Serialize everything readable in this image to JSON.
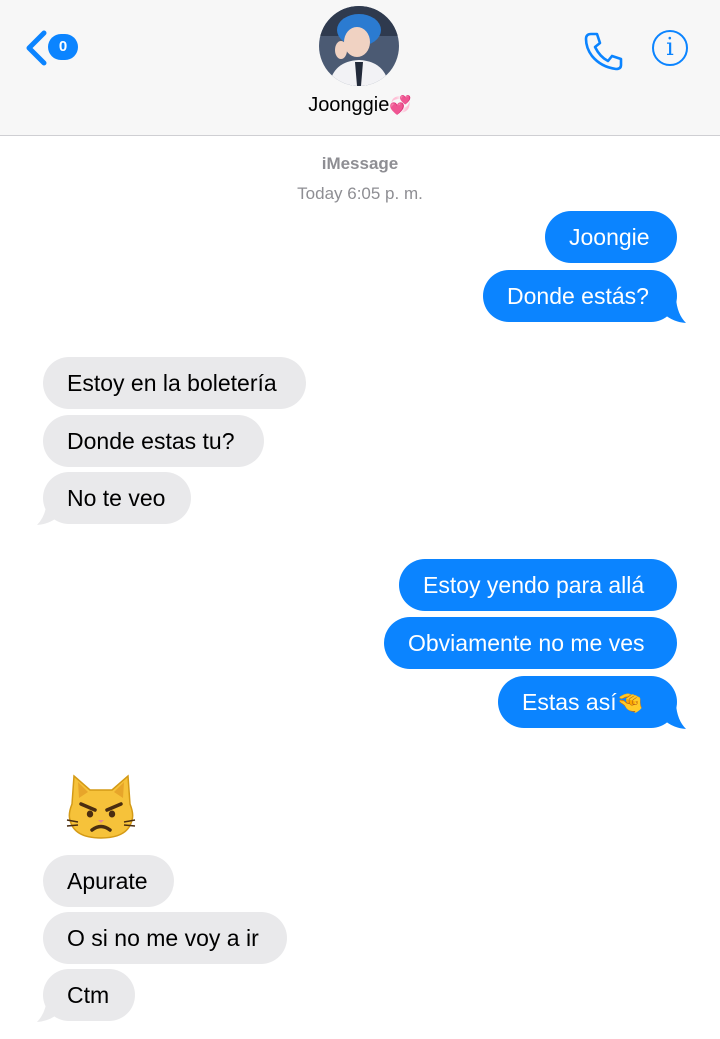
{
  "header": {
    "unread_count": "0",
    "contact_name": "Joonggie",
    "contact_emoji": "💞",
    "info_glyph": "i"
  },
  "conversation": {
    "service": "iMessage",
    "timestamp": "Today 6:05 p. m."
  },
  "messages": [
    {
      "direction": "sent",
      "text": "Joongie"
    },
    {
      "direction": "sent",
      "text": "Donde estás?"
    },
    {
      "direction": "received",
      "text": "Estoy en la boletería"
    },
    {
      "direction": "received",
      "text": "Donde estas tu?"
    },
    {
      "direction": "received",
      "text": "No te veo"
    },
    {
      "direction": "sent",
      "text": "Estoy yendo para allá"
    },
    {
      "direction": "sent",
      "text": "Obviamente no me ves"
    },
    {
      "direction": "sent",
      "text": "Estas así",
      "emoji": "🤏"
    },
    {
      "direction": "received",
      "emoji_only": "pouting-cat-icon"
    },
    {
      "direction": "received",
      "text": "Apurate"
    },
    {
      "direction": "received",
      "text": "O si no me voy a ir"
    },
    {
      "direction": "received",
      "text": "Ctm"
    }
  ],
  "colors": {
    "sent_bubble": "#0b84ff",
    "received_bubble": "#e9e9eb",
    "accent": "#0b84ff",
    "meta_text": "#8e8e93"
  }
}
